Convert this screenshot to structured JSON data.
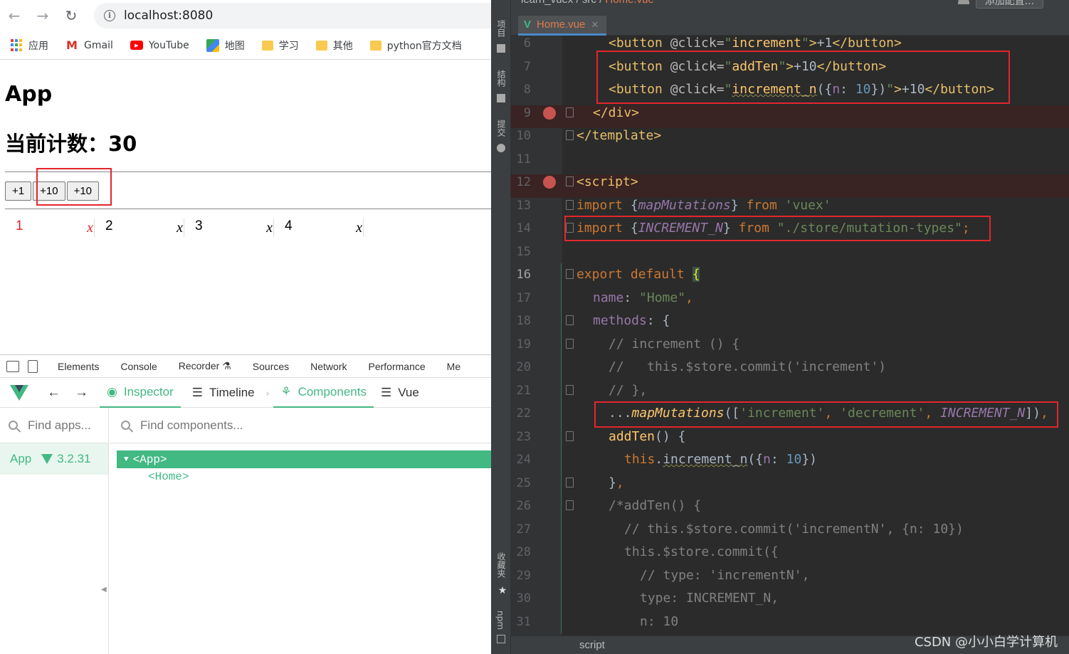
{
  "browser": {
    "url": "localhost:8080",
    "bookmarks": [
      {
        "label": "应用",
        "icon": "apps-grid-icon"
      },
      {
        "label": "Gmail",
        "icon": "gmail-icon"
      },
      {
        "label": "YouTube",
        "icon": "youtube-icon"
      },
      {
        "label": "地图",
        "icon": "maps-icon"
      },
      {
        "label": "学习",
        "icon": "folder-icon"
      },
      {
        "label": "其他",
        "icon": "folder-icon"
      },
      {
        "label": "python官方文档",
        "icon": "folder-icon"
      }
    ]
  },
  "page": {
    "title": "App",
    "counter_text": "当前计数：30",
    "buttons": [
      "+1",
      "+10",
      "+10"
    ],
    "list_items": [
      {
        "num": "1",
        "mark": "x"
      },
      {
        "num": "2",
        "mark": "x"
      },
      {
        "num": "3",
        "mark": "x"
      },
      {
        "num": "4",
        "mark": "x"
      }
    ]
  },
  "devtools": {
    "tabs": [
      "Elements",
      "Console",
      "Recorder",
      "Sources",
      "Network",
      "Performance",
      "Me"
    ],
    "vue_tabs": [
      "Inspector",
      "Timeline",
      "Components",
      "Vue"
    ],
    "find_apps_placeholder": "Find apps...",
    "find_components_placeholder": "Find components...",
    "app_name": "App",
    "vue_version": "3.2.31",
    "tree": [
      "<App>",
      "<Home>"
    ]
  },
  "ide": {
    "breadcrumb": [
      "learn_vuex",
      "src",
      "Home.vue"
    ],
    "config_button": "添加配置...",
    "file_tab": "Home.vue",
    "side_labels": [
      "项目",
      "结构",
      "提交",
      "收藏夹",
      "npm"
    ],
    "status": "script",
    "line_numbers": [
      "6",
      "7",
      "8",
      "9",
      "10",
      "11",
      "12",
      "13",
      "14",
      "15",
      "16",
      "17",
      "18",
      "19",
      "20",
      "21",
      "22",
      "23",
      "24",
      "25",
      "26",
      "27",
      "28",
      "29",
      "30",
      "31"
    ]
  },
  "watermark": "CSDN @小小白学计算机",
  "colors": {
    "vue_green": "#42b883",
    "highlight_red": "#e3262c",
    "ide_bg": "#2b2b2b"
  }
}
